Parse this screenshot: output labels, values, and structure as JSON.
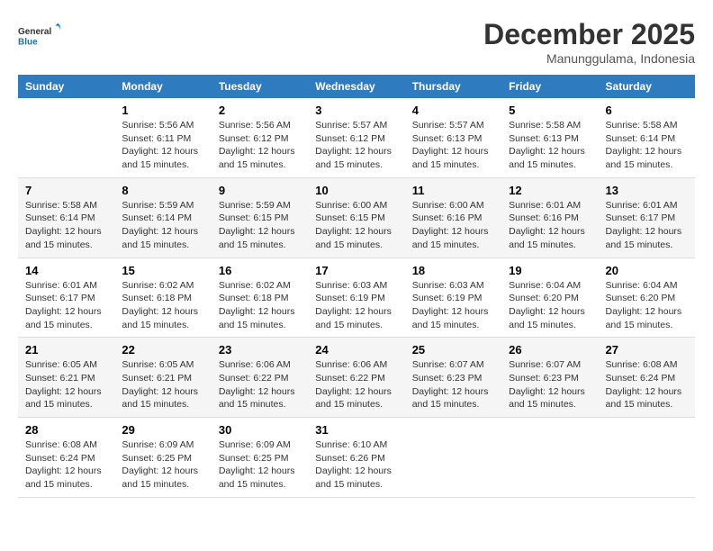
{
  "logo": {
    "line1": "General",
    "line2": "Blue"
  },
  "title": "December 2025",
  "subtitle": "Manunggulama, Indonesia",
  "header_days": [
    "Sunday",
    "Monday",
    "Tuesday",
    "Wednesday",
    "Thursday",
    "Friday",
    "Saturday"
  ],
  "weeks": [
    [
      {
        "day": "",
        "sunrise": "",
        "sunset": "",
        "daylight": ""
      },
      {
        "day": "1",
        "sunrise": "Sunrise: 5:56 AM",
        "sunset": "Sunset: 6:11 PM",
        "daylight": "Daylight: 12 hours and 15 minutes."
      },
      {
        "day": "2",
        "sunrise": "Sunrise: 5:56 AM",
        "sunset": "Sunset: 6:12 PM",
        "daylight": "Daylight: 12 hours and 15 minutes."
      },
      {
        "day": "3",
        "sunrise": "Sunrise: 5:57 AM",
        "sunset": "Sunset: 6:12 PM",
        "daylight": "Daylight: 12 hours and 15 minutes."
      },
      {
        "day": "4",
        "sunrise": "Sunrise: 5:57 AM",
        "sunset": "Sunset: 6:13 PM",
        "daylight": "Daylight: 12 hours and 15 minutes."
      },
      {
        "day": "5",
        "sunrise": "Sunrise: 5:58 AM",
        "sunset": "Sunset: 6:13 PM",
        "daylight": "Daylight: 12 hours and 15 minutes."
      },
      {
        "day": "6",
        "sunrise": "Sunrise: 5:58 AM",
        "sunset": "Sunset: 6:14 PM",
        "daylight": "Daylight: 12 hours and 15 minutes."
      }
    ],
    [
      {
        "day": "7",
        "sunrise": "Sunrise: 5:58 AM",
        "sunset": "Sunset: 6:14 PM",
        "daylight": "Daylight: 12 hours and 15 minutes."
      },
      {
        "day": "8",
        "sunrise": "Sunrise: 5:59 AM",
        "sunset": "Sunset: 6:14 PM",
        "daylight": "Daylight: 12 hours and 15 minutes."
      },
      {
        "day": "9",
        "sunrise": "Sunrise: 5:59 AM",
        "sunset": "Sunset: 6:15 PM",
        "daylight": "Daylight: 12 hours and 15 minutes."
      },
      {
        "day": "10",
        "sunrise": "Sunrise: 6:00 AM",
        "sunset": "Sunset: 6:15 PM",
        "daylight": "Daylight: 12 hours and 15 minutes."
      },
      {
        "day": "11",
        "sunrise": "Sunrise: 6:00 AM",
        "sunset": "Sunset: 6:16 PM",
        "daylight": "Daylight: 12 hours and 15 minutes."
      },
      {
        "day": "12",
        "sunrise": "Sunrise: 6:01 AM",
        "sunset": "Sunset: 6:16 PM",
        "daylight": "Daylight: 12 hours and 15 minutes."
      },
      {
        "day": "13",
        "sunrise": "Sunrise: 6:01 AM",
        "sunset": "Sunset: 6:17 PM",
        "daylight": "Daylight: 12 hours and 15 minutes."
      }
    ],
    [
      {
        "day": "14",
        "sunrise": "Sunrise: 6:01 AM",
        "sunset": "Sunset: 6:17 PM",
        "daylight": "Daylight: 12 hours and 15 minutes."
      },
      {
        "day": "15",
        "sunrise": "Sunrise: 6:02 AM",
        "sunset": "Sunset: 6:18 PM",
        "daylight": "Daylight: 12 hours and 15 minutes."
      },
      {
        "day": "16",
        "sunrise": "Sunrise: 6:02 AM",
        "sunset": "Sunset: 6:18 PM",
        "daylight": "Daylight: 12 hours and 15 minutes."
      },
      {
        "day": "17",
        "sunrise": "Sunrise: 6:03 AM",
        "sunset": "Sunset: 6:19 PM",
        "daylight": "Daylight: 12 hours and 15 minutes."
      },
      {
        "day": "18",
        "sunrise": "Sunrise: 6:03 AM",
        "sunset": "Sunset: 6:19 PM",
        "daylight": "Daylight: 12 hours and 15 minutes."
      },
      {
        "day": "19",
        "sunrise": "Sunrise: 6:04 AM",
        "sunset": "Sunset: 6:20 PM",
        "daylight": "Daylight: 12 hours and 15 minutes."
      },
      {
        "day": "20",
        "sunrise": "Sunrise: 6:04 AM",
        "sunset": "Sunset: 6:20 PM",
        "daylight": "Daylight: 12 hours and 15 minutes."
      }
    ],
    [
      {
        "day": "21",
        "sunrise": "Sunrise: 6:05 AM",
        "sunset": "Sunset: 6:21 PM",
        "daylight": "Daylight: 12 hours and 15 minutes."
      },
      {
        "day": "22",
        "sunrise": "Sunrise: 6:05 AM",
        "sunset": "Sunset: 6:21 PM",
        "daylight": "Daylight: 12 hours and 15 minutes."
      },
      {
        "day": "23",
        "sunrise": "Sunrise: 6:06 AM",
        "sunset": "Sunset: 6:22 PM",
        "daylight": "Daylight: 12 hours and 15 minutes."
      },
      {
        "day": "24",
        "sunrise": "Sunrise: 6:06 AM",
        "sunset": "Sunset: 6:22 PM",
        "daylight": "Daylight: 12 hours and 15 minutes."
      },
      {
        "day": "25",
        "sunrise": "Sunrise: 6:07 AM",
        "sunset": "Sunset: 6:23 PM",
        "daylight": "Daylight: 12 hours and 15 minutes."
      },
      {
        "day": "26",
        "sunrise": "Sunrise: 6:07 AM",
        "sunset": "Sunset: 6:23 PM",
        "daylight": "Daylight: 12 hours and 15 minutes."
      },
      {
        "day": "27",
        "sunrise": "Sunrise: 6:08 AM",
        "sunset": "Sunset: 6:24 PM",
        "daylight": "Daylight: 12 hours and 15 minutes."
      }
    ],
    [
      {
        "day": "28",
        "sunrise": "Sunrise: 6:08 AM",
        "sunset": "Sunset: 6:24 PM",
        "daylight": "Daylight: 12 hours and 15 minutes."
      },
      {
        "day": "29",
        "sunrise": "Sunrise: 6:09 AM",
        "sunset": "Sunset: 6:25 PM",
        "daylight": "Daylight: 12 hours and 15 minutes."
      },
      {
        "day": "30",
        "sunrise": "Sunrise: 6:09 AM",
        "sunset": "Sunset: 6:25 PM",
        "daylight": "Daylight: 12 hours and 15 minutes."
      },
      {
        "day": "31",
        "sunrise": "Sunrise: 6:10 AM",
        "sunset": "Sunset: 6:26 PM",
        "daylight": "Daylight: 12 hours and 15 minutes."
      },
      {
        "day": "",
        "sunrise": "",
        "sunset": "",
        "daylight": ""
      },
      {
        "day": "",
        "sunrise": "",
        "sunset": "",
        "daylight": ""
      },
      {
        "day": "",
        "sunrise": "",
        "sunset": "",
        "daylight": ""
      }
    ]
  ]
}
